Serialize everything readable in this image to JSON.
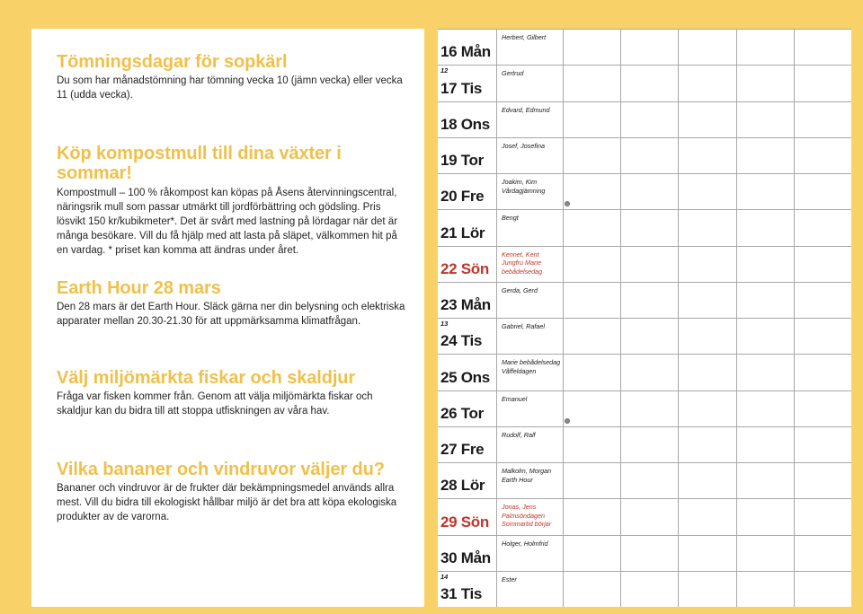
{
  "theme": {
    "background_yellow": "#F8D269",
    "panel_white": "#FFFFFF",
    "heading_yellow": "#F0C04A",
    "sunday_red": "#C1352B",
    "grid_gray": "#A8A8A8"
  },
  "info_blocks": [
    {
      "id": "tomning",
      "heading": "Tömningsdagar för sopkärl",
      "body": "Du som har månadstömning har tömning vecka 10 (jämn vecka) eller vecka 11 (udda vecka)."
    },
    {
      "id": "kompost",
      "heading": "Köp kompostmull till dina växter i sommar!",
      "body": "Kompostmull – 100 % råkompost kan köpas på Åsens återvinningscentral, näringsrik mull som passar utmärkt till jordförbättring och gödsling.\nPris lösvikt 150 kr/kubikmeter*. Det är svårt med lastning på lördagar när det är många besökare. Vill du få hjälp med att lasta på släpet, välkommen hit på en vardag.\n* priset kan komma att ändras under året."
    },
    {
      "id": "earthhour",
      "heading": "Earth Hour 28 mars",
      "body": "Den 28 mars är det Earth Hour. Släck gärna ner din belysning och elektriska apparater mellan 20.30-21.30 för att uppmärksamma klimatfrågan."
    },
    {
      "id": "fisk",
      "heading": "Välj miljömärkta fiskar och skaldjur",
      "body": "Fråga var fisken kommer från. Genom att välja miljömärkta fiskar och skaldjur kan du bidra till att stoppa utfiskningen av våra hav."
    },
    {
      "id": "bananer",
      "heading": "Vilka bananer och vindruvor väljer du?",
      "body": "Bananer och vindruvor är de frukter där bekämpningsmedel används allra mest. Vill du bidra till ekologiskt hållbar miljö är det bra att köpa ekologiska produkter av de varorna."
    }
  ],
  "calendar": {
    "blank_columns": 5,
    "rows": [
      {
        "week": "",
        "day": "16 Mån",
        "sunday": false,
        "names": "Herbert, Gilbert",
        "moon": false
      },
      {
        "week": "12",
        "day": "17 Tis",
        "sunday": false,
        "names": "Gertrud",
        "moon": false
      },
      {
        "week": "",
        "day": "18 Ons",
        "sunday": false,
        "names": "Edvard, Edmund",
        "moon": false
      },
      {
        "week": "",
        "day": "19 Tor",
        "sunday": false,
        "names": "Josef, Josefina",
        "moon": false
      },
      {
        "week": "",
        "day": "20 Fre",
        "sunday": false,
        "names": "Joakim, Kim\nVårdagjämning",
        "moon": true
      },
      {
        "week": "",
        "day": "21 Lör",
        "sunday": false,
        "names": "Bengt",
        "moon": false
      },
      {
        "week": "",
        "day": "22 Sön",
        "sunday": true,
        "names": "Kennet, Kent\nJungfru Marie\nbebådelsedag",
        "moon": false
      },
      {
        "week": "",
        "day": "23 Mån",
        "sunday": false,
        "names": "Gerda, Gerd",
        "moon": false
      },
      {
        "week": "13",
        "day": "24 Tis",
        "sunday": false,
        "names": "Gabriel, Rafael",
        "moon": false
      },
      {
        "week": "",
        "day": "25 Ons",
        "sunday": false,
        "names": "Marie bebådelsedag\nVåffeldagen",
        "moon": false
      },
      {
        "week": "",
        "day": "26 Tor",
        "sunday": false,
        "names": "Emanuel",
        "moon": true
      },
      {
        "week": "",
        "day": "27 Fre",
        "sunday": false,
        "names": "Rudolf, Ralf",
        "moon": false
      },
      {
        "week": "",
        "day": "28 Lör",
        "sunday": false,
        "names": "Malkolm, Morgan\nEarth Hour",
        "moon": false
      },
      {
        "week": "",
        "day": "29 Sön",
        "sunday": true,
        "names": "Jonas, Jens\nPalmsöndagen\nSommartid börjar",
        "moon": false
      },
      {
        "week": "",
        "day": "30 Mån",
        "sunday": false,
        "names": "Holger, Holmfrid",
        "moon": false
      },
      {
        "week": "14",
        "day": "31 Tis",
        "sunday": false,
        "names": "Ester",
        "moon": false
      }
    ]
  }
}
